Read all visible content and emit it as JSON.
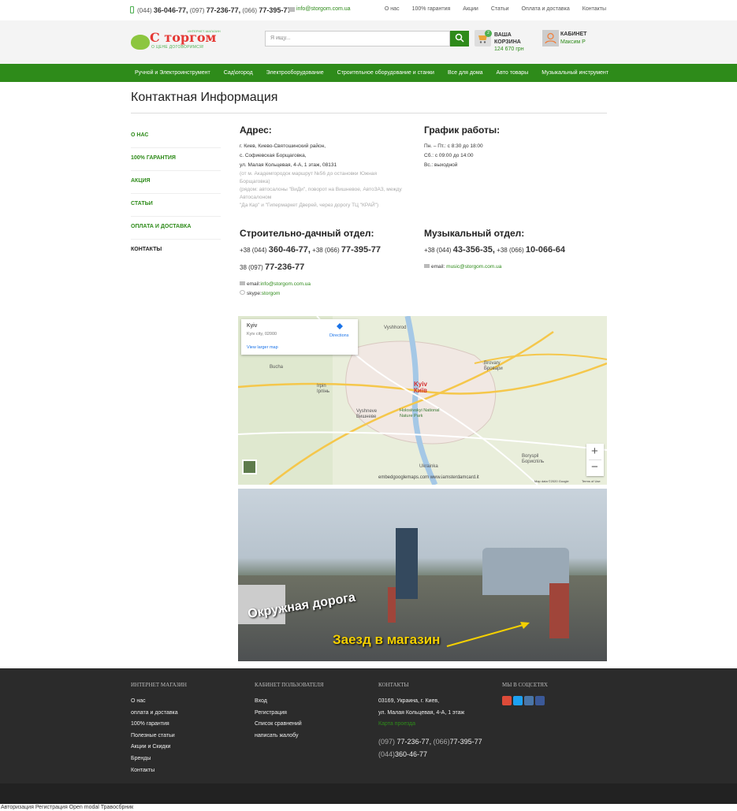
{
  "topbar": {
    "phones": [
      {
        "code": "(044)",
        "number": "36-046-77,"
      },
      {
        "code": "(097)",
        "number": "77-236-77,"
      },
      {
        "code": "(066)",
        "number": "77-395-77"
      }
    ],
    "email": "info@storgom.com.ua",
    "links": [
      "О нас",
      "100% гарантия",
      "Акции",
      "Статьи",
      "Оплата и доставка",
      "Контакты"
    ]
  },
  "header": {
    "logo_top": "ИНТЕРНЕТ-МАГАЗИН",
    "logo_text": "С торгом",
    "logo_sub": "О ЦЕНЕ ДОГОВОРИМСЯ!",
    "search_placeholder": "Я ищу...",
    "cart_count": "2",
    "cart_label_1": "ВАША",
    "cart_label_2": "КОРЗИНА",
    "cart_sum": "124 670 грн",
    "cabinet_label": "КАБИНЕТ",
    "cabinet_user": "Максим Р"
  },
  "nav": [
    "Ручной и Электроинструмент",
    "Сад\\огород",
    "Электрооборудование",
    "Строительное оборудование и станки",
    "Все для дома",
    "Авто товары",
    "Музыкальный инструмент"
  ],
  "page_title": "Контактная Информация",
  "sidebar": [
    "О нас",
    "100% гарантия",
    "Акция",
    "Статьи",
    "Оплата и доставка",
    "Контакты"
  ],
  "address": {
    "title": "Адрес:",
    "lines": [
      "г. Киев, Киево-Святошинский район,",
      "с. Софиевская Борщаговка,",
      "ул. Малая Кольцевая, 4-А, 1 этаж, 08131"
    ],
    "grey_lines": [
      "(от м. Академгородок маршрут №56 до остановки Южная",
      "Борщаговка)",
      "(рядом: автосалоны \"ВиДи\", поворот на Вишневое, АвтоЗАЗ, между",
      "Автосалоном",
      "\"Да Кар\" и \"Гипермаркет Дверей, через дорогу ТЦ \"КРАЙ\")"
    ]
  },
  "schedule": {
    "title": "График работы:",
    "lines": [
      "Пн. – Пт.: с 8:30 до 18:00",
      "Сб.: с 09:00 до 14:00",
      "Вс.: выходной"
    ]
  },
  "construction": {
    "title": "Строительно-дачный отдел:",
    "phones": [
      {
        "code": "+38 (044)",
        "number": "360-46-77,"
      },
      {
        "code": "+38 (066)",
        "number": "77-395-77"
      },
      {
        "code": "38 (097)",
        "number": "77-236-77"
      }
    ],
    "email_label": "email:",
    "email": "info@storgom.com.ua",
    "skype_label": "skype:",
    "skype": "storgom"
  },
  "music": {
    "title": "Музыкальный отдел:",
    "phones": [
      {
        "code": "+38 (044)",
        "number": "43-356-35,"
      },
      {
        "code": "+38 (066)",
        "number": "10-066-64"
      }
    ],
    "email_label": "email:",
    "email": "music@storgom.com.ua"
  },
  "map": {
    "card_title": "Kyiv",
    "card_sub": "Kyiv city, 02000",
    "directions": "Directions",
    "larger": "View larger map",
    "city_label_1": "Kyiv",
    "city_label_2": "Київ",
    "places": [
      "Brovary",
      "Бровари",
      "Irpin",
      "Ірпінь",
      "Boryspil",
      "Бориспіль",
      "Vyshneve",
      "Вишневе",
      "Holosiivskyi National Nature Park",
      "Vyshhorod",
      "Bucha",
      "Ukrainka"
    ],
    "embed": "embedgooglemaps.com www.iamsterdamcard.it",
    "data": "Map data ©2020 Google",
    "terms": "Terms of Use"
  },
  "photo": {
    "caption_1": "Окружная дорога",
    "caption_2": "Заезд в магазин"
  },
  "footer": {
    "shop_title": "ИНТЕРНЕТ МАГАЗИН",
    "shop_links": [
      "О нас",
      "оплата и доставка",
      "100% гарантия",
      "Полезные статьи",
      "Акции и Скидки",
      "Бренды",
      "Контакты"
    ],
    "cabinet_title": "КАБИНЕТ ПОЛЬЗОВАТЕЛЯ",
    "cabinet_links": [
      "Вход",
      "Регистрация",
      "Список сравнений",
      "написать жалобу"
    ],
    "contacts_title": "КОНТАКТЫ",
    "contacts_lines": [
      "03169, Украина, г. Киев,",
      "ул. Малая Кольцевая, 4-А, 1 этаж"
    ],
    "map_link": "Карта проезда",
    "phone_line_1": {
      "c1": "(097)",
      "n1": "77-236-77,",
      "c2": "(066)",
      "n2": "77-395-77"
    },
    "phone_line_2": {
      "c1": "(044)",
      "n1": "360-46-77"
    },
    "social_title": "МЫ В СОЦСЕТЯХ"
  },
  "bottom_strip": "Авторизация Регистрация Open modal Травосбрник",
  "colors": {
    "accent": "#2e8b1a",
    "footer": "#2b2b2b",
    "logo_red": "#e53935"
  }
}
